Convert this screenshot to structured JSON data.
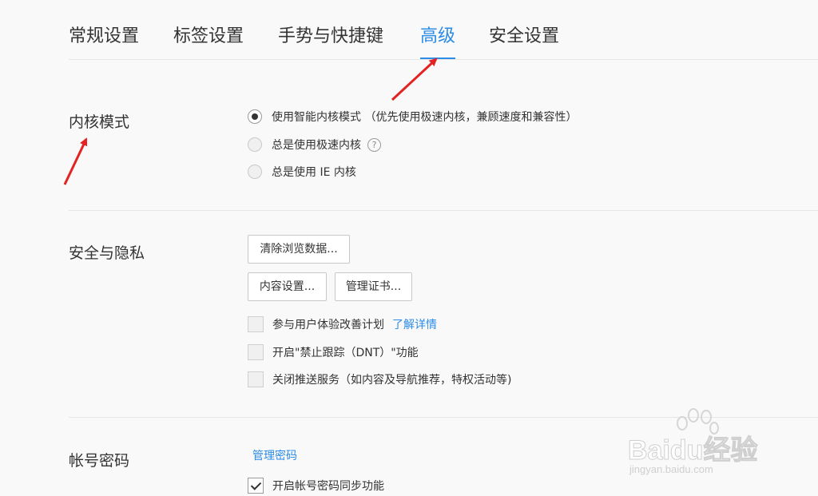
{
  "tabs": [
    {
      "label": "常规设置",
      "active": false
    },
    {
      "label": "标签设置",
      "active": false
    },
    {
      "label": "手势与快捷键",
      "active": false
    },
    {
      "label": "高级",
      "active": true
    },
    {
      "label": "安全设置",
      "active": false
    }
  ],
  "kernel": {
    "title": "内核模式",
    "options": [
      {
        "label": "使用智能内核模式 （优先使用极速内核，兼顾速度和兼容性）",
        "checked": true
      },
      {
        "label": "总是使用极速内核",
        "checked": false,
        "help": "?"
      },
      {
        "label": "总是使用 IE 内核",
        "checked": false
      }
    ]
  },
  "privacy": {
    "title": "安全与隐私",
    "clear_data_label": "清除浏览数据...",
    "content_settings_label": "内容设置...",
    "manage_cert_label": "管理证书...",
    "checkboxes": [
      {
        "label": "参与用户体验改善计划",
        "checked": false,
        "link": "了解详情"
      },
      {
        "label": "开启\"禁止跟踪（DNT）\"功能",
        "checked": false
      },
      {
        "label": "关闭推送服务（如内容及导航推荐，特权活动等)",
        "checked": false
      }
    ]
  },
  "account": {
    "title": "帐号密码",
    "manage_password_label": "管理密码",
    "sync_label": "开启帐号密码同步功能",
    "sync_checked": true
  },
  "watermark": {
    "text": "Baidu经验",
    "url": "jingyan.baidu.com"
  },
  "colors": {
    "accent": "#2c8ce6",
    "annotation_arrow": "#e32222"
  }
}
